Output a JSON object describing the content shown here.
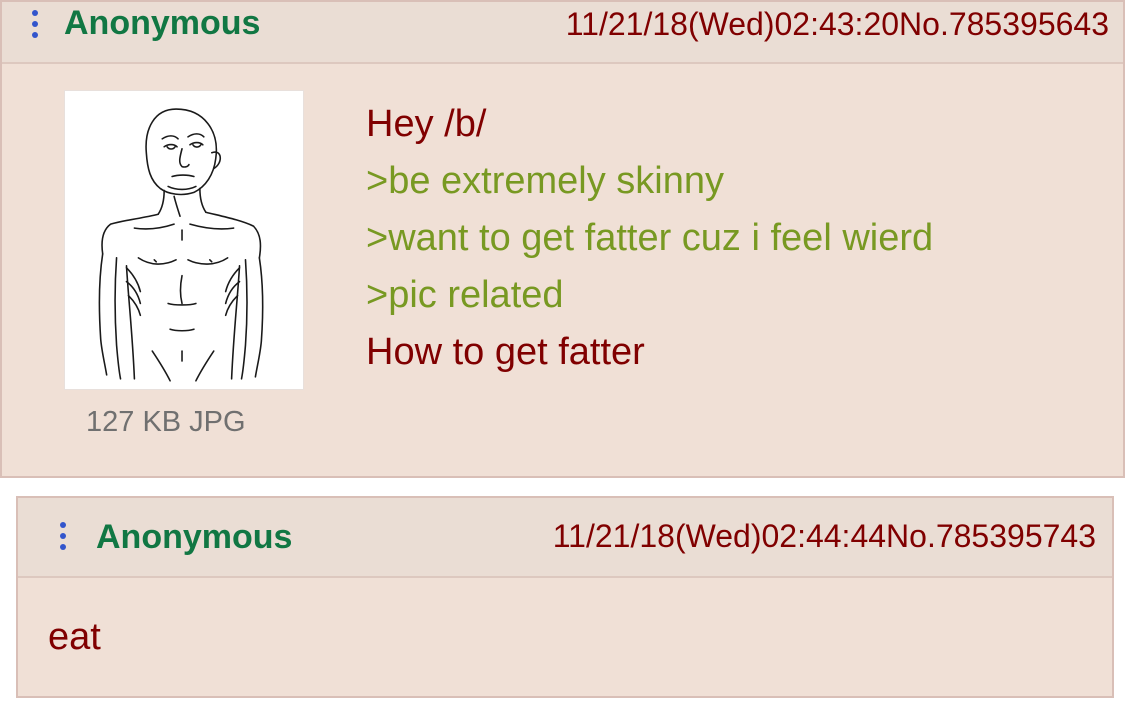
{
  "colors": {
    "post_bg": "#f0e0d6",
    "post_border": "#d9bfb7",
    "name": "#117743",
    "meta": "#800000",
    "greentext": "#789922",
    "menu_dots": "#3355cc"
  },
  "posts": [
    {
      "name": "Anonymous",
      "datetime": "11/21/18(Wed)02:43:20",
      "number": "No.785395643",
      "image": {
        "icon": "wojak-skinny-drawing",
        "file_info": "127 KB JPG"
      },
      "lines": [
        {
          "text": "Hey /b/",
          "quote": false
        },
        {
          "text": ">be extremely skinny",
          "quote": true
        },
        {
          "text": ">want to get fatter cuz i feel wierd",
          "quote": true
        },
        {
          "text": ">pic related",
          "quote": true
        },
        {
          "text": "How to get fatter",
          "quote": false
        }
      ]
    },
    {
      "name": "Anonymous",
      "datetime": "11/21/18(Wed)02:44:44",
      "number": "No.785395743",
      "body": "eat"
    }
  ]
}
